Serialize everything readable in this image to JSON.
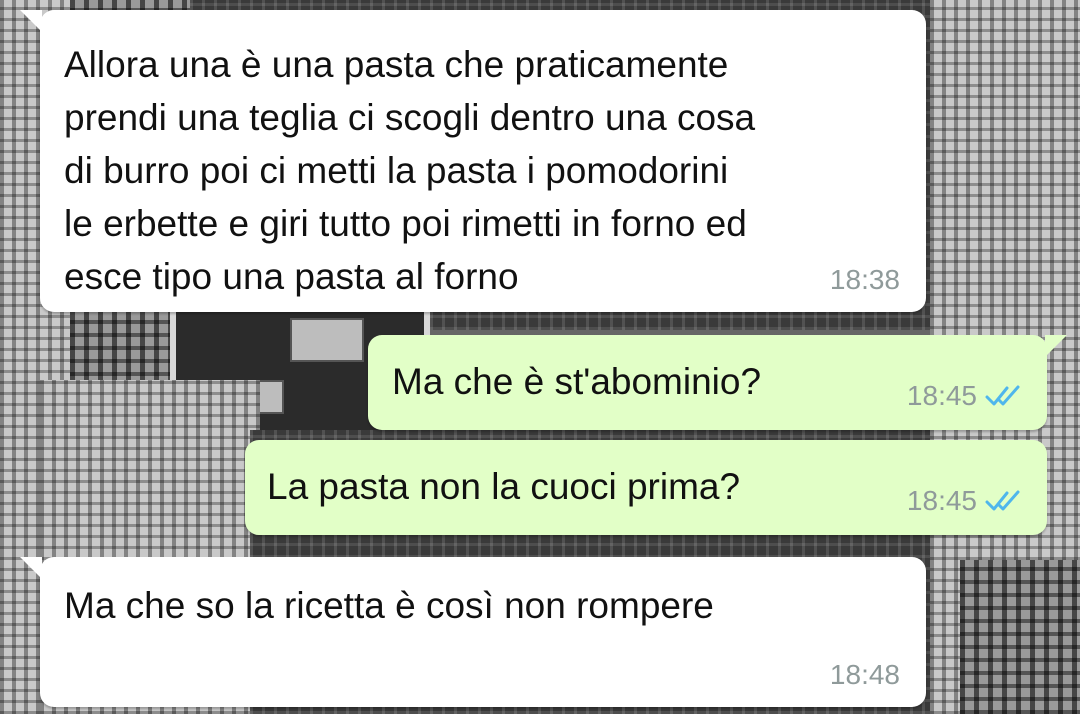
{
  "theme": {
    "incoming_bubble": "#ffffff",
    "outgoing_bubble": "#e2ffc7",
    "timestamp_color": "#8f9a9a",
    "read_tick_color": "#4fb6ec"
  },
  "messages": [
    {
      "direction": "incoming",
      "text": "Allora una è una pasta che praticamente\nprendi una teglia ci scogli dentro una cosa\ndi burro poi ci metti la pasta i pomodorini\nle erbette e giri tutto poi rimetti in forno ed\nesce tipo una pasta al forno",
      "time": "18:38"
    },
    {
      "direction": "outgoing",
      "text": "Ma che è st'abominio?",
      "time": "18:45",
      "status_icon": "double-check-read-icon"
    },
    {
      "direction": "outgoing",
      "text": "La pasta non la cuoci prima?",
      "time": "18:45",
      "status_icon": "double-check-read-icon"
    },
    {
      "direction": "incoming",
      "text": "Ma che so la ricetta è così non rompere",
      "time": "18:48"
    }
  ]
}
